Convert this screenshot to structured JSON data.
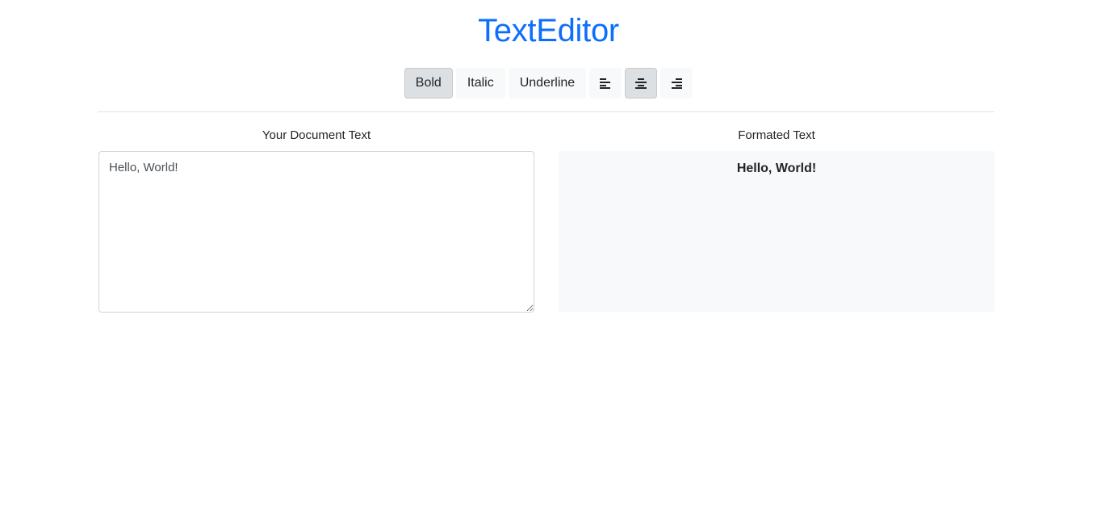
{
  "app": {
    "title": "TextEditor",
    "accent_color": "#0d6efd"
  },
  "toolbar": {
    "bold_label": "Bold",
    "italic_label": "Italic",
    "underline_label": "Underline",
    "align_left_icon": "align-left-icon",
    "align_center_icon": "align-center-icon",
    "align_right_icon": "align-right-icon",
    "active": [
      "bold",
      "align-center"
    ]
  },
  "editor": {
    "label": "Your Document Text",
    "value": "Hello, World!"
  },
  "preview": {
    "label": "Formated Text",
    "text": "Hello, World!",
    "alignment": "center",
    "bold": true,
    "italic": false,
    "underline": false
  }
}
